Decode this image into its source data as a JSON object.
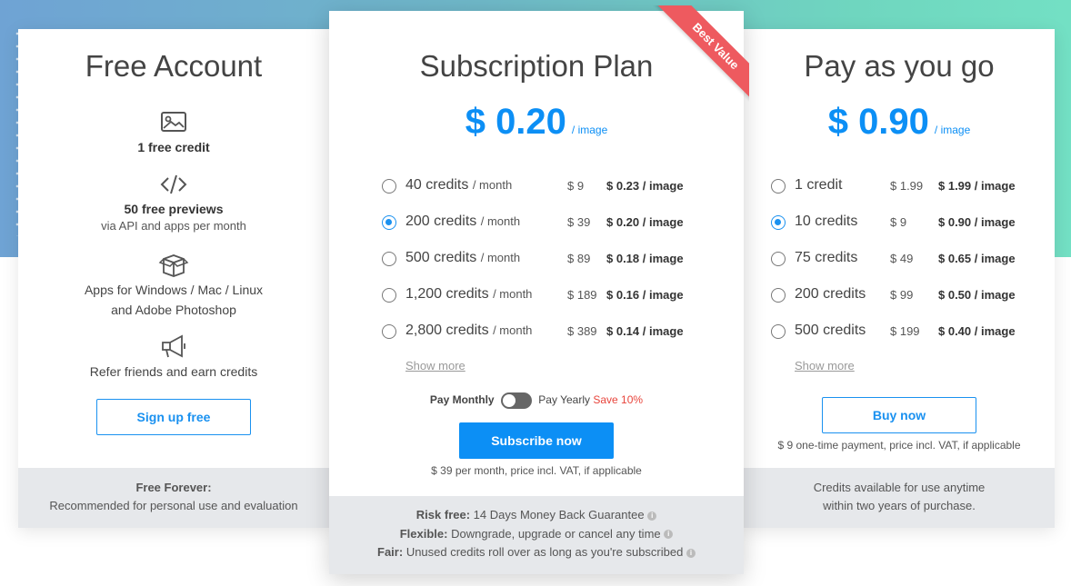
{
  "free": {
    "title": "Free Account",
    "features": [
      {
        "icon": "image-icon",
        "strong": "1 free credit"
      },
      {
        "icon": "code-icon",
        "strong": "50 free previews",
        "small": "via API and apps per month"
      },
      {
        "icon": "box-icon",
        "line1": "Apps for Windows / Mac / Linux",
        "line2": "and Adobe Photoshop"
      },
      {
        "icon": "megaphone-icon",
        "line1": "Refer friends and earn credits"
      }
    ],
    "button": "Sign up free",
    "footer_title": "Free Forever:",
    "footer_text": "Recommended for personal use and evaluation"
  },
  "subscription": {
    "title": "Subscription Plan",
    "ribbon": "Best Value",
    "price": "$ 0.20",
    "price_unit": "/ image",
    "options": [
      {
        "credits": "40 credits",
        "per": "/ month",
        "cost": "$ 9",
        "rate": "$ 0.23 / image",
        "checked": false
      },
      {
        "credits": "200 credits",
        "per": "/ month",
        "cost": "$ 39",
        "rate": "$ 0.20 / image",
        "checked": true
      },
      {
        "credits": "500 credits",
        "per": "/ month",
        "cost": "$ 89",
        "rate": "$ 0.18 / image",
        "checked": false
      },
      {
        "credits": "1,200 credits",
        "per": "/ month",
        "cost": "$ 189",
        "rate": "$ 0.16 / image",
        "checked": false
      },
      {
        "credits": "2,800 credits",
        "per": "/ month",
        "cost": "$ 389",
        "rate": "$ 0.14 / image",
        "checked": false
      }
    ],
    "show_more": "Show more",
    "toggle_monthly": "Pay Monthly",
    "toggle_yearly": "Pay Yearly",
    "toggle_save": "Save 10%",
    "button": "Subscribe now",
    "note": "$ 39 per month, price incl. VAT, if applicable",
    "footer": [
      {
        "label": "Risk free:",
        "text": "14 Days Money Back Guarantee"
      },
      {
        "label": "Flexible:",
        "text": "Downgrade, upgrade or cancel any time"
      },
      {
        "label": "Fair:",
        "text": "Unused credits roll over as long as you're subscribed"
      }
    ]
  },
  "payg": {
    "title": "Pay as you go",
    "price": "$ 0.90",
    "price_unit": "/ image",
    "options": [
      {
        "credits": "1 credit",
        "cost": "$ 1.99",
        "rate": "$ 1.99 / image",
        "checked": false
      },
      {
        "credits": "10 credits",
        "cost": "$ 9",
        "rate": "$ 0.90 / image",
        "checked": true
      },
      {
        "credits": "75 credits",
        "cost": "$ 49",
        "rate": "$ 0.65 / image",
        "checked": false
      },
      {
        "credits": "200 credits",
        "cost": "$ 99",
        "rate": "$ 0.50 / image",
        "checked": false
      },
      {
        "credits": "500 credits",
        "cost": "$ 199",
        "rate": "$ 0.40 / image",
        "checked": false
      }
    ],
    "show_more": "Show more",
    "button": "Buy now",
    "note": "$ 9 one-time payment, price incl. VAT, if applicable",
    "footer_line1": "Credits available for use anytime",
    "footer_line2": "within two years of purchase."
  },
  "colors": {
    "accent": "#0c8ff5",
    "ribbon": "#ee5a5f",
    "save": "#e8453c",
    "footer_bg": "#e6e8eb"
  }
}
